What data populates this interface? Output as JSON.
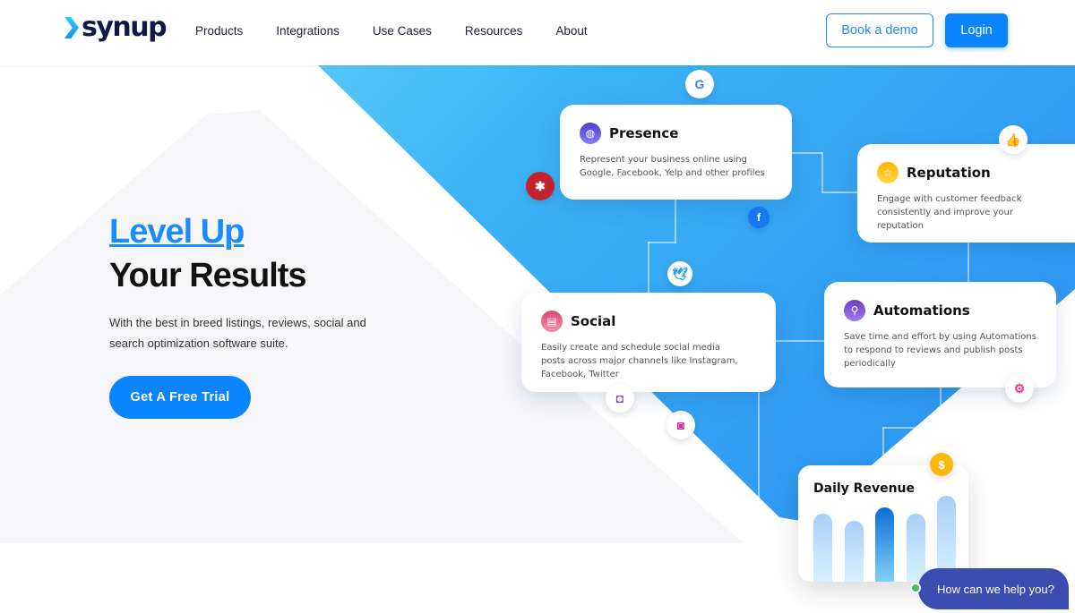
{
  "nav": {
    "logo": "synup",
    "items": [
      "Products",
      "Integrations",
      "Use Cases",
      "Resources",
      "About"
    ],
    "book_demo": "Book a demo",
    "login": "Login"
  },
  "hero": {
    "title_line1": "Level Up",
    "title_line2": "Your Results",
    "subtitle": "With the best in breed listings, reviews, social and search optimization software suite.",
    "cta": "Get A Free Trial"
  },
  "cards": [
    {
      "title": "Presence",
      "text": "Represent your business online using Google, Facebook, Yelp and other profiles",
      "icon": "globe-icon"
    },
    {
      "title": "Reputation",
      "text": "Engage with customer feedback consistently and improve your reputation",
      "icon": "star-icon"
    },
    {
      "title": "Social",
      "text": "Easily create and schedule social media posts across major channels like Instagram, Facebook, Twitter",
      "icon": "document-icon"
    },
    {
      "title": "Automations",
      "text": "Save time and effort by using Automations to respond to reviews and publish posts periodically",
      "icon": "workflow-icon"
    }
  ],
  "revenue": {
    "title": "Daily Revenue",
    "bars": [
      0.76,
      0.68,
      0.83,
      0.76,
      0.96
    ],
    "highlight_index": 2
  },
  "chat": {
    "text": "How can we help you?",
    "status_color": "#3fc15a"
  },
  "colors": {
    "accent": "#0a84ff",
    "navy": "#12174a",
    "chat": "#3b4db0"
  }
}
